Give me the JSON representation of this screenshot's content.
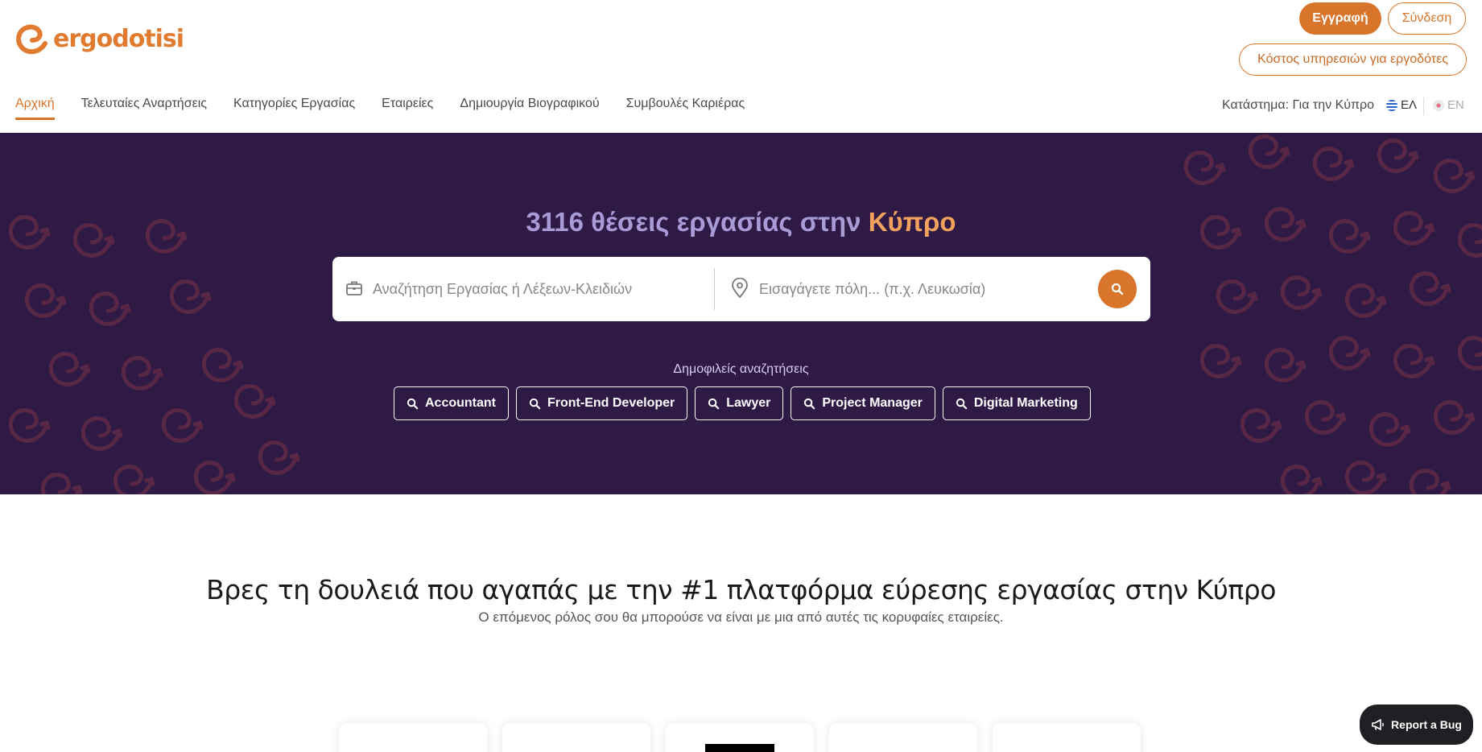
{
  "brand": {
    "name": "ergodotisi",
    "accent": "#d9742b",
    "hero_bg": "#2f1a45"
  },
  "header": {
    "register_label": "Εγγραφή",
    "login_label": "Σύνδεση",
    "employers_label": "Κόστος υπηρεσιών για εργοδότες"
  },
  "nav": {
    "items": [
      {
        "label": "Αρχική",
        "active": true
      },
      {
        "label": "Τελευταίες Αναρτήσεις"
      },
      {
        "label": "Κατηγορίες Εργασίας"
      },
      {
        "label": "Εταιρείες"
      },
      {
        "label": "Δημιουργία Βιογραφικού"
      },
      {
        "label": "Συμβουλές Καριέρας"
      }
    ],
    "store_label": "Κατάστημα: Για την Κύπρο",
    "lang_el": "ΕΛ",
    "lang_en": "EN"
  },
  "hero": {
    "title_prefix": "3116 θέσεις εργασίας στην ",
    "title_city": "Κύπρο",
    "search_placeholder": "Αναζήτηση Εργασίας ή Λέξεων-Κλειδιών",
    "location_placeholder": "Εισαγάγετε πόλη... (π.χ. Λευκωσία)",
    "popular_label": "Δημοφιλείς αναζητήσεις",
    "popular": [
      "Accountant",
      "Front-End Developer",
      "Lawyer",
      "Project Manager",
      "Digital Marketing"
    ]
  },
  "content": {
    "tagline": "Βρες τη δουλειά που αγαπάς με την #1 πλατφόρμα εύρεσης εργασίας στην Κύπρο",
    "subtagline": "Ο επόμενος ρόλος σου θα μπορούσε να είναι με μια από αυτές τις κορυφαίες εταιρείες."
  },
  "report_bug_label": "Report a Bug"
}
